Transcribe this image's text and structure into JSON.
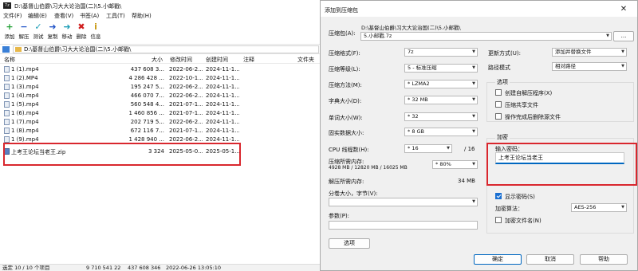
{
  "file_manager": {
    "title": "D:\\基督山伯爵\\习大大论治国(二)\\5.小邮戳\\",
    "logo": "7z",
    "menu": [
      "文件(F)",
      "编辑(E)",
      "查看(V)",
      "书签(A)",
      "工具(T)",
      "帮助(H)"
    ],
    "toolbar": [
      {
        "label": "添加",
        "icon": "add-icon",
        "glyph": "+",
        "color": "#22a035"
      },
      {
        "label": "解压",
        "icon": "extract-icon",
        "glyph": "−",
        "color": "#2456c8"
      },
      {
        "label": "测试",
        "icon": "test-icon",
        "glyph": "✓",
        "color": "#1f9fb8"
      },
      {
        "label": "复制",
        "icon": "copy-icon",
        "glyph": "➜",
        "color": "#2456c8"
      },
      {
        "label": "移动",
        "icon": "move-icon",
        "glyph": "➜",
        "color": "#1f9fb8"
      },
      {
        "label": "删除",
        "icon": "delete-icon",
        "glyph": "✖",
        "color": "#d01f1f"
      },
      {
        "label": "信息",
        "icon": "info-icon",
        "glyph": "i",
        "color": "#c99a14"
      }
    ],
    "address": "D:\\基督山伯爵\\习大大论治国(二)\\5.小邮戳\\",
    "columns": [
      "名称",
      "大小",
      "修改时间",
      "创建时间",
      "注释",
      "文件夹"
    ],
    "files": [
      {
        "name": "1 (1).mp4",
        "size": "437 608 3...",
        "modified": "2022-06-2...",
        "created": "2024-11-1..."
      },
      {
        "name": "1 (2).MP4",
        "size": "4 286 428 ...",
        "modified": "2022-10-1...",
        "created": "2024-11-1..."
      },
      {
        "name": "1 (3).mp4",
        "size": "195 247 5...",
        "modified": "2022-06-2...",
        "created": "2024-11-1..."
      },
      {
        "name": "1 (4).mp4",
        "size": "466 070 7...",
        "modified": "2022-06-2...",
        "created": "2024-11-1..."
      },
      {
        "name": "1 (5).mp4",
        "size": "560 548 4...",
        "modified": "2021-07-1...",
        "created": "2024-11-1..."
      },
      {
        "name": "1 (6).mp4",
        "size": "1 460 856 ...",
        "modified": "2021-07-1...",
        "created": "2024-11-1..."
      },
      {
        "name": "1 (7).mp4",
        "size": "202 719 5...",
        "modified": "2022-06-2...",
        "created": "2024-11-1..."
      },
      {
        "name": "1 (8).mp4",
        "size": "672 116 7...",
        "modified": "2021-07-1...",
        "created": "2024-11-1..."
      },
      {
        "name": "1 (9).mp4",
        "size": "1 428 940 ...",
        "modified": "2022-06-2...",
        "created": "2024-11-1..."
      },
      {
        "name": "上考王论坛当老王.zip",
        "size": "3 324",
        "modified": "2025-05-0...",
        "created": "2025-05-1..."
      }
    ],
    "status": {
      "selection": "选定 10 / 10 个项目",
      "total": "9 710 541 22",
      "total2": "437 608 346",
      "date": "2022-06-26 13:05:10"
    }
  },
  "dialog": {
    "title": "添加到压缩包",
    "close_glyph": "✕",
    "archive_label": "压缩包(A):",
    "archive_path": "D:\\基督山伯爵\\习大大论治国(二)\\5.小邮戳\\",
    "archive_name": "5.小邮戳.7z",
    "browse": "...",
    "format_label": "压缩格式(F):",
    "format_value": "7z",
    "level_label": "压缩等级(L):",
    "level_value": "5 - 标准压缩",
    "method_label": "压缩方法(M):",
    "method_value": "* LZMA2",
    "dict_label": "字典大小(D):",
    "dict_value": "* 32 MB",
    "word_label": "单词大小(W):",
    "word_value": "* 32",
    "solid_label": "固实数据大小:",
    "solid_value": "* 8 GB",
    "threads_label": "CPU 线程数(H):",
    "threads_value": "* 16",
    "threads_total": "/ 16",
    "memory_label": "压缩所需内存:",
    "memory_detail": "4928 MB / 12820 MB / 16025 MB",
    "memory_value": "* 80%",
    "decomp_label": "解压所需内存:",
    "decomp_value": "34 MB",
    "split_label": "分卷大小，字节(V):",
    "params_label": "参数(P):",
    "options_button": "选项",
    "update_label": "更新方式(U):",
    "update_value": "添加并替换文件",
    "path_label": "路径模式",
    "path_value": "相对路径",
    "options_group": "选项",
    "opt_sfx": "创建自解压程序(X)",
    "opt_shared": "压缩共享文件",
    "opt_delete": "操作完成后删除源文件",
    "encrypt_group": "加密",
    "pwd_label": "输入密码：",
    "pwd_value": "上考王论坛当老王",
    "show_pwd": "显示密码(S)",
    "enc_method_label": "加密算法：",
    "enc_method_value": "AES-256",
    "enc_names": "加密文件名(N)",
    "ok": "确定",
    "cancel": "取消",
    "help": "帮助"
  }
}
